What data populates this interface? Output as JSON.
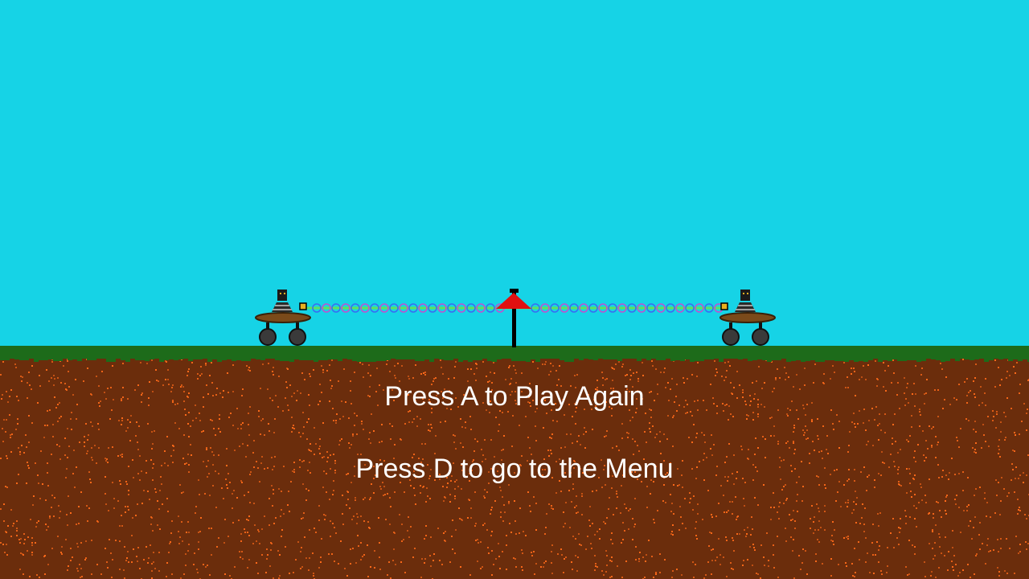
{
  "colors": {
    "sky": "#16d3e6",
    "grass": "#1d6b1a",
    "dirt": "#6b2d0c",
    "dirt_speck": "#ff6a1a",
    "flag": "#e01010",
    "rope_main": "#5fe05f",
    "rope_helix_a": "#3a6cf0",
    "rope_helix_b": "#c050d0",
    "text": "#ffffff"
  },
  "prompts": {
    "play_again": "Press A to Play Again",
    "menu": "Press D to go to the Menu"
  },
  "icons": {
    "left_player": "robot-cart-icon",
    "right_player": "robot-cart-icon",
    "center_marker": "red-flag-icon"
  }
}
